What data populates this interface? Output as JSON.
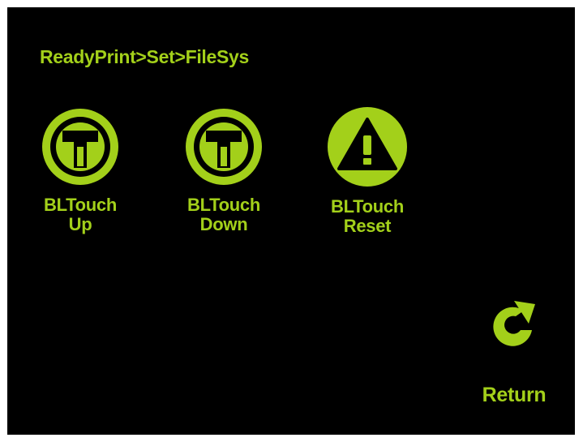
{
  "breadcrumb": "ReadyPrint>Set>FileSys",
  "buttons": [
    {
      "line1": "BLTouch",
      "line2": "Up",
      "icon": "bltouch-probe-icon"
    },
    {
      "line1": "BLTouch",
      "line2": "Down",
      "icon": "bltouch-probe-icon"
    },
    {
      "line1": "BLTouch",
      "line2": "Reset",
      "icon": "warning-icon"
    }
  ],
  "return_label": "Return",
  "colors": {
    "accent": "#a3d01a",
    "background": "#000000",
    "frame": "#ffffff"
  }
}
